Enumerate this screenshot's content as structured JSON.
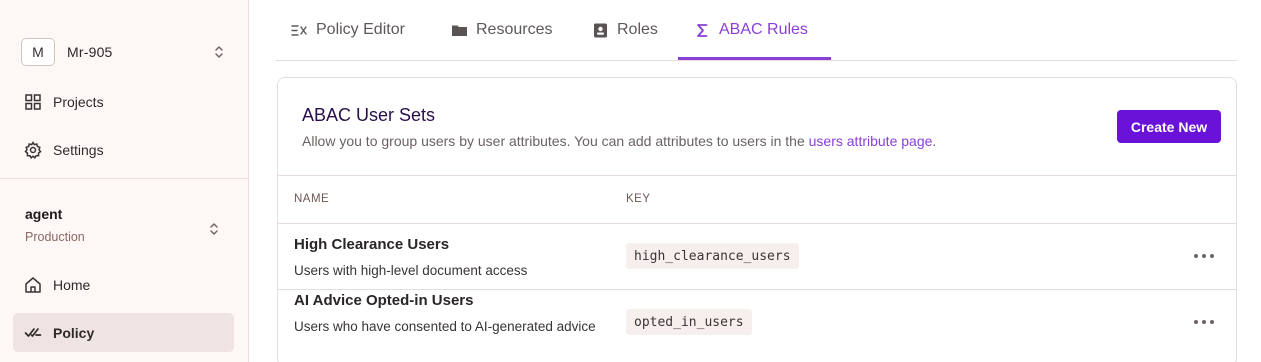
{
  "sidebar": {
    "org": {
      "initial": "M",
      "name": "Mr-905"
    },
    "top_items": [
      {
        "label": "Projects",
        "icon": "grid-icon"
      },
      {
        "label": "Settings",
        "icon": "gear-icon"
      }
    ],
    "environment": {
      "name": "agent",
      "sub": "Production"
    },
    "env_items": [
      {
        "label": "Home",
        "icon": "home-icon"
      },
      {
        "label": "Policy",
        "icon": "policy-check-icon",
        "active": true
      }
    ]
  },
  "tabs": [
    {
      "label": "Policy Editor",
      "icon": "policy-editor-icon"
    },
    {
      "label": "Resources",
      "icon": "folder-icon"
    },
    {
      "label": "Roles",
      "icon": "id-badge-icon"
    },
    {
      "label": "ABAC Rules",
      "icon": "sigma-icon",
      "active": true
    }
  ],
  "card": {
    "title": "ABAC User Sets",
    "description": "Allow you to group users by user attributes. You can add attributes to users in the ",
    "description_link": "users attribute page",
    "description_end": ".",
    "create_button": "Create New",
    "columns": [
      "NAME",
      "KEY"
    ],
    "rows": [
      {
        "name": "High Clearance Users",
        "description": "Users with high-level document access",
        "key": "high_clearance_users"
      },
      {
        "name": "AI Advice Opted-in Users",
        "description": "Users who have consented to AI-generated advice",
        "key": "opted_in_users"
      }
    ]
  },
  "colors": {
    "accent": "#8a3fd6",
    "button": "#6a12d8"
  }
}
